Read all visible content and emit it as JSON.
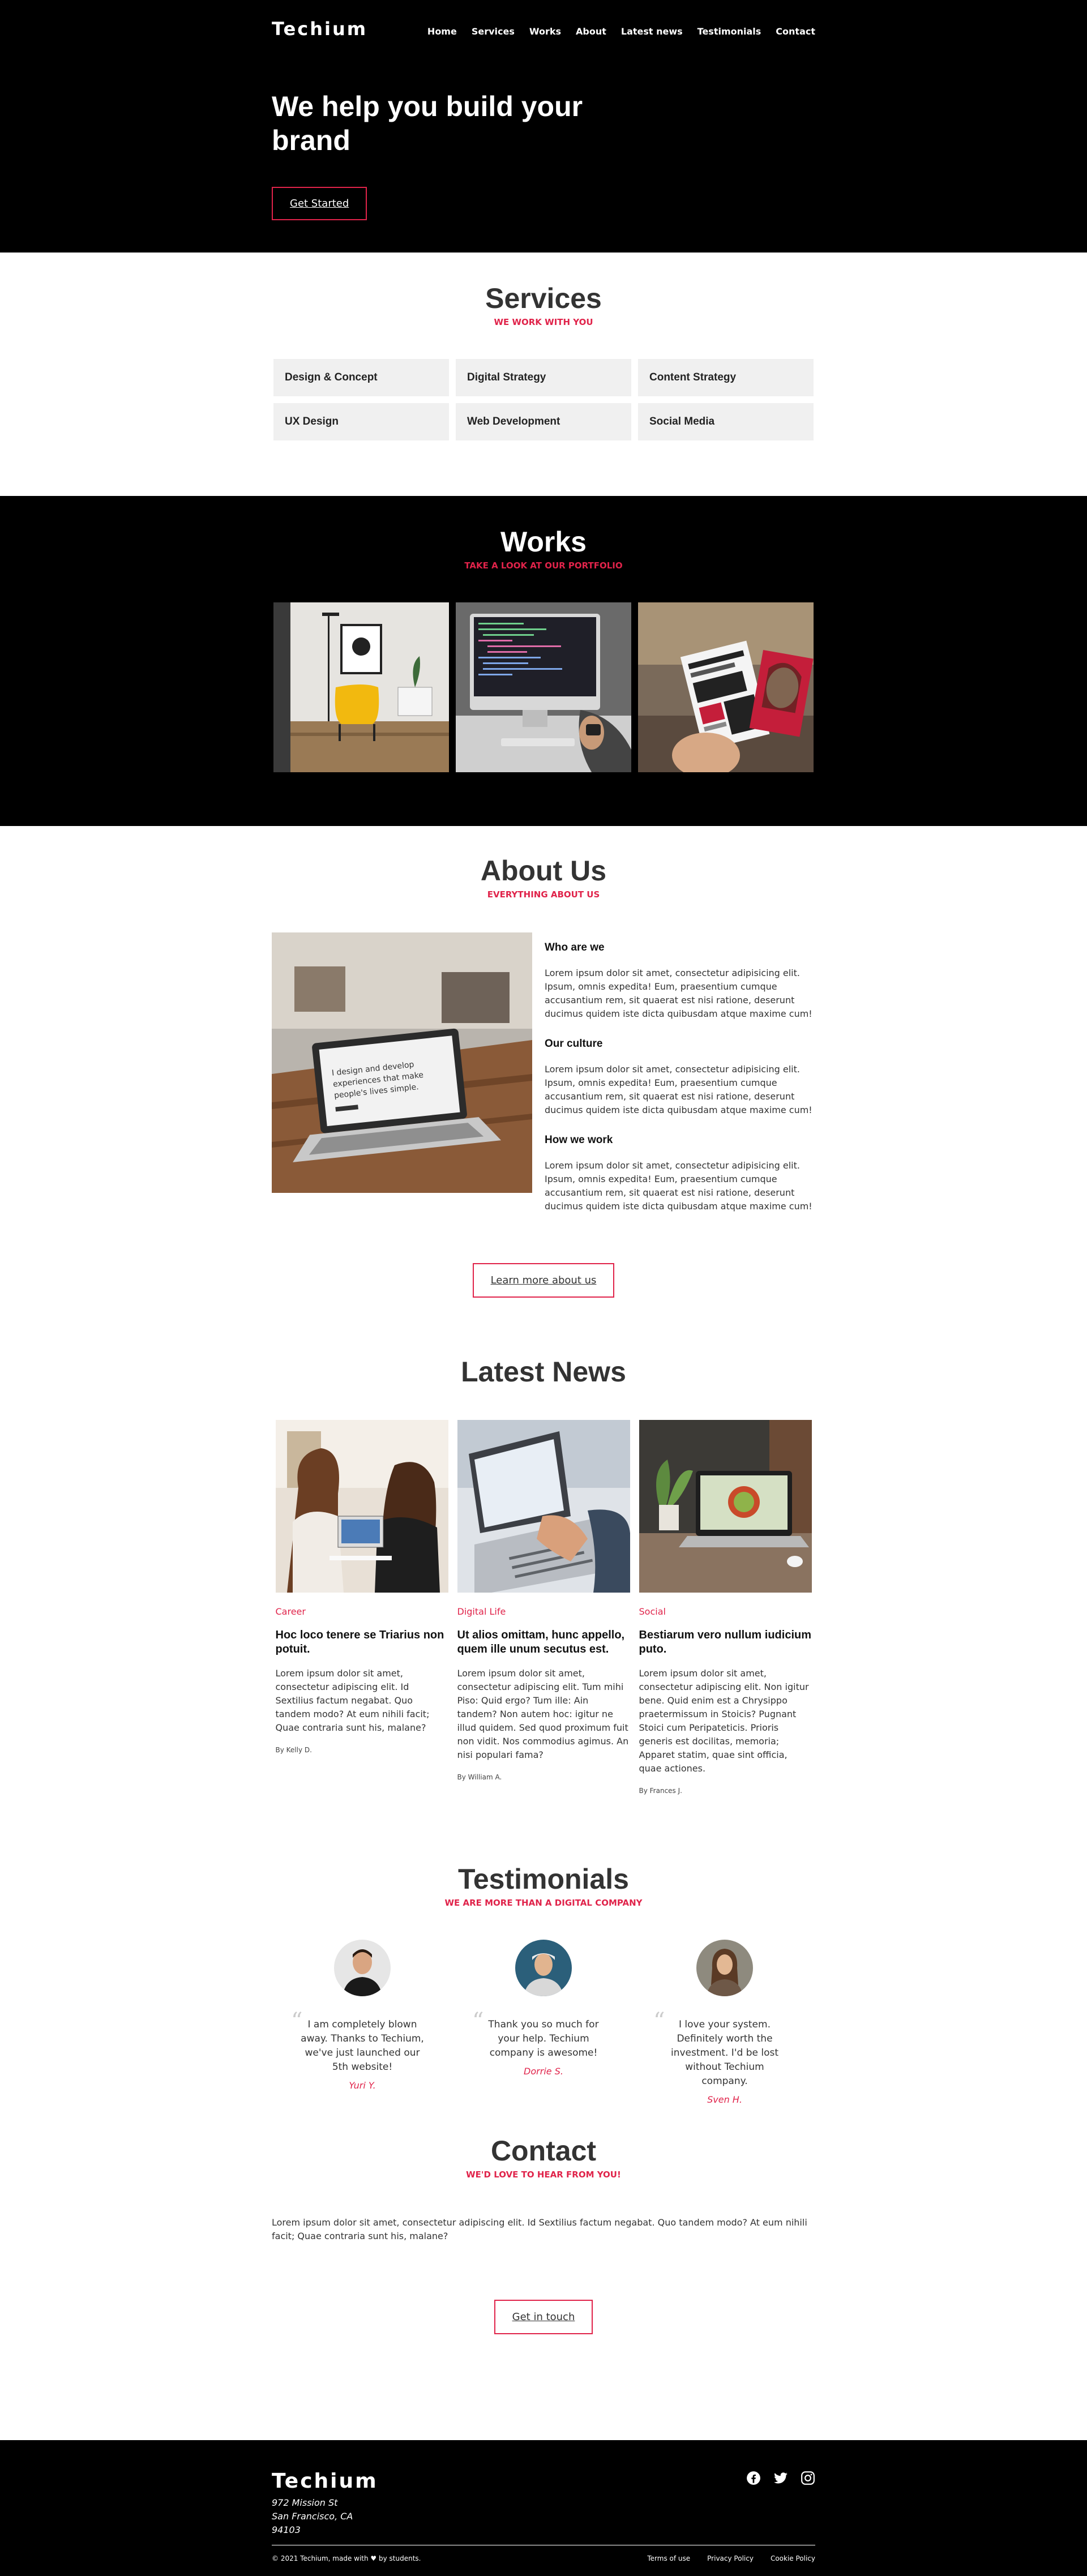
{
  "brand": "Techium",
  "nav": [
    "Home",
    "Services",
    "Works",
    "About",
    "Latest news",
    "Testimonials",
    "Contact"
  ],
  "hero": {
    "title": "We help you build your brand",
    "cta": "Get Started"
  },
  "services": {
    "title": "Services",
    "subtitle": "WE WORK WITH YOU",
    "items": [
      "Design & Concept",
      "Digital Strategy",
      "Content Strategy",
      "UX Design",
      "Web Development",
      "Social Media"
    ]
  },
  "works": {
    "title": "Works",
    "subtitle": "TAKE A LOOK AT OUR PORTFOLIO"
  },
  "about": {
    "title": "About Us",
    "subtitle": "EVERYTHING ABOUT US",
    "blocks": [
      {
        "heading": "Who are we",
        "text": "Lorem ipsum dolor sit amet, consectetur adipisicing elit. Ipsum, omnis expedita! Eum, praesentium cumque accusantium rem, sit quaerat est nisi ratione, deserunt ducimus quidem iste dicta quibusdam atque maxime cum!"
      },
      {
        "heading": "Our culture",
        "text": "Lorem ipsum dolor sit amet, consectetur adipisicing elit. Ipsum, omnis expedita! Eum, praesentium cumque accusantium rem, sit quaerat est nisi ratione, deserunt ducimus quidem iste dicta quibusdam atque maxime cum!"
      },
      {
        "heading": "How we work",
        "text": "Lorem ipsum dolor sit amet, consectetur adipisicing elit. Ipsum, omnis expedita! Eum, praesentium cumque accusantium rem, sit quaerat est nisi ratione, deserunt ducimus quidem iste dicta quibusdam atque maxime cum!"
      }
    ],
    "laptop_screen_text": "I design and develop experiences that make people's lives simple.",
    "cta": "Learn more about us"
  },
  "news": {
    "title": "Latest News",
    "items": [
      {
        "category": "Career",
        "title": "Hoc loco tenere se Triarius non potuit.",
        "text": "Lorem ipsum dolor sit amet, consectetur adipiscing elit. Id Sextilius factum negabat. Quo tandem modo? At eum nihili facit; Quae contraria sunt his, malane?",
        "author": "By Kelly D."
      },
      {
        "category": "Digital Life",
        "title": "Ut alios omittam, hunc appello, quem ille unum secutus est.",
        "text": "Lorem ipsum dolor sit amet, consectetur adipiscing elit. Tum mihi Piso: Quid ergo? Tum ille: Ain tandem? Non autem hoc: igitur ne illud quidem. Sed quod proximum fuit non vidit. Nos commodius agimus. An nisi populari fama?",
        "author": "By William A."
      },
      {
        "category": "Social",
        "title": "Bestiarum vero nullum iudicium puto.",
        "text": "Lorem ipsum dolor sit amet, consectetur adipiscing elit. Non igitur bene. Quid enim est a Chrysippo praetermissum in Stoicis? Pugnant Stoici cum Peripateticis. Prioris generis est docilitas, memoria; Apparet statim, quae sint officia, quae actiones.",
        "author": "By Frances J."
      }
    ]
  },
  "testimonials": {
    "title": "Testimonials",
    "subtitle": "WE ARE MORE THAN A DIGITAL COMPANY",
    "items": [
      {
        "quote": "I am completely blown away. Thanks to Techium, we've just launched our 5th website!",
        "author": "Yuri Y."
      },
      {
        "quote": "Thank you so much for your help. Techium company is awesome!",
        "author": "Dorrie S."
      },
      {
        "quote": "I love your system. Definitely worth the investment. I'd be lost without Techium company.",
        "author": "Sven H."
      }
    ]
  },
  "contact": {
    "title": "Contact",
    "subtitle": "WE'D LOVE TO HEAR FROM YOU!",
    "text": "Lorem ipsum dolor sit amet, consectetur adipiscing elit. Id Sextilius factum negabat. Quo tandem modo? At eum nihili facit; Quae contraria sunt his, malane?",
    "cta": "Get in touch"
  },
  "footer": {
    "brand": "Techium",
    "address": [
      "972 Mission St",
      "San Francisco, CA",
      "94103"
    ],
    "copyright": "© 2021 Techium, made with ♥ by students.",
    "links": [
      "Terms of use",
      "Privacy Policy",
      "Cookie Policy"
    ],
    "socials": [
      "facebook-icon",
      "twitter-icon",
      "instagram-icon"
    ]
  },
  "colors": {
    "accent": "#e0234a",
    "dark": "#000000",
    "card": "#f0f0f0"
  }
}
